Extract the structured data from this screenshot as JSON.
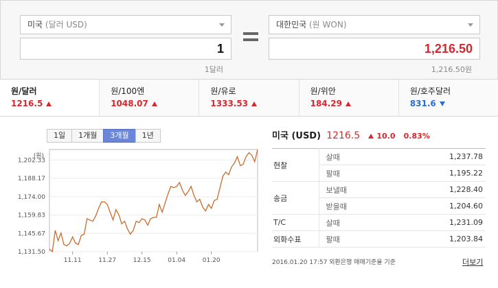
{
  "converter": {
    "from": {
      "country": "미국",
      "unit": "(달러 USD)",
      "amount": "1",
      "sub": "1달러"
    },
    "to": {
      "country": "대한민국",
      "unit": "(원 WON)",
      "amount": "1,216.50",
      "sub": "1,216.50원"
    }
  },
  "tabs": [
    {
      "name": "원/달러",
      "value": "1216.5",
      "dir": "up"
    },
    {
      "name": "원/100엔",
      "value": "1048.07",
      "dir": "up"
    },
    {
      "name": "원/유로",
      "value": "1333.53",
      "dir": "up"
    },
    {
      "name": "원/위안",
      "value": "184.29",
      "dir": "up"
    },
    {
      "name": "원/호주달러",
      "value": "831.6",
      "dir": "down"
    }
  ],
  "periods": [
    "1일",
    "1개월",
    "3개월",
    "1년"
  ],
  "active_period": "3개월",
  "chart_data": {
    "type": "line",
    "unit_label": "(원)",
    "y_ticks": [
      "1,202.33",
      "1,188.17",
      "1,174.00",
      "1,159.83",
      "1,145.67",
      "1,131.50"
    ],
    "y_tick_values": [
      1202.33,
      1188.17,
      1174.0,
      1159.83,
      1145.67,
      1131.5
    ],
    "ylim": [
      1131.5,
      1210.5
    ],
    "x_ticks": [
      "11.11",
      "11.27",
      "12.15",
      "01.04",
      "01.20"
    ],
    "x_tick_index": [
      8,
      20,
      32,
      44,
      56
    ],
    "values": [
      1133.5,
      1131.5,
      1148,
      1140,
      1146,
      1137,
      1136,
      1138,
      1143,
      1138,
      1137,
      1144,
      1145,
      1157,
      1156,
      1155,
      1159,
      1165,
      1170,
      1170,
      1168,
      1162,
      1156,
      1164,
      1160,
      1153,
      1155,
      1149,
      1145,
      1148,
      1155,
      1154,
      1157,
      1156,
      1152,
      1157,
      1158,
      1158,
      1168,
      1162,
      1169,
      1176,
      1182,
      1181,
      1182,
      1185,
      1179,
      1175,
      1178,
      1182,
      1175,
      1170,
      1172,
      1166,
      1163,
      1168,
      1165,
      1171,
      1172,
      1181,
      1190,
      1193,
      1191,
      1197,
      1200,
      1205,
      1198,
      1199,
      1205,
      1208,
      1206,
      1201,
      1210.5
    ],
    "color": "#c96b2c"
  },
  "info": {
    "country": "미국 (USD)",
    "rate": "1216.5",
    "change": "10.0",
    "percent": "0.83%",
    "rows": [
      {
        "cat": "현찰",
        "kind": "살때",
        "value": "1,237.78"
      },
      {
        "cat": "",
        "kind": "팔때",
        "value": "1,195.22"
      },
      {
        "cat": "송금",
        "kind": "보낼때",
        "value": "1,228.40"
      },
      {
        "cat": "",
        "kind": "받을때",
        "value": "1,204.60"
      },
      {
        "cat": "T/C",
        "kind": "살때",
        "value": "1,231.09"
      },
      {
        "cat": "외화수표",
        "kind": "팔때",
        "value": "1,203.84"
      }
    ],
    "footnote": "2016.01.20 17:57 외환은행 매매기준율 기준",
    "more": "더보기"
  },
  "colors": {
    "up": "#d9262c",
    "down": "#2a6ed2",
    "active_period": "#6b86d6"
  }
}
